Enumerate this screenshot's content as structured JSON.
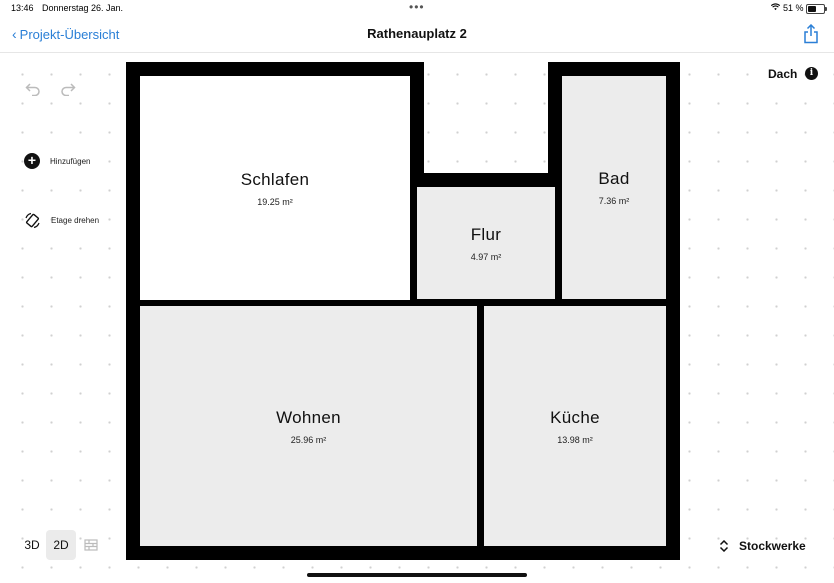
{
  "status": {
    "time": "13:46",
    "date": "Donnerstag 26. Jan.",
    "battery": "51 %"
  },
  "nav": {
    "back_label": "Projekt-Übersicht",
    "title": "Rathenauplatz 2"
  },
  "tools": {
    "add_label": "Hinzufügen",
    "rotate_label": "Etage drehen"
  },
  "rooms": [
    {
      "name": "Schlafen",
      "area": "19.25 m²"
    },
    {
      "name": "Flur",
      "area": "4.97 m²"
    },
    {
      "name": "Bad",
      "area": "7.36 m²"
    },
    {
      "name": "Wohnen",
      "area": "25.96 m²"
    },
    {
      "name": "Küche",
      "area": "13.98 m²"
    }
  ],
  "floor": {
    "name": "Dach",
    "floors_label": "Stockwerke"
  },
  "view_modes": {
    "mode_3d": "3D",
    "mode_2d": "2D",
    "active": "2D"
  },
  "colors": {
    "accent": "#2a7fd6",
    "wall": "#000000",
    "room_fill": "#ececec"
  }
}
